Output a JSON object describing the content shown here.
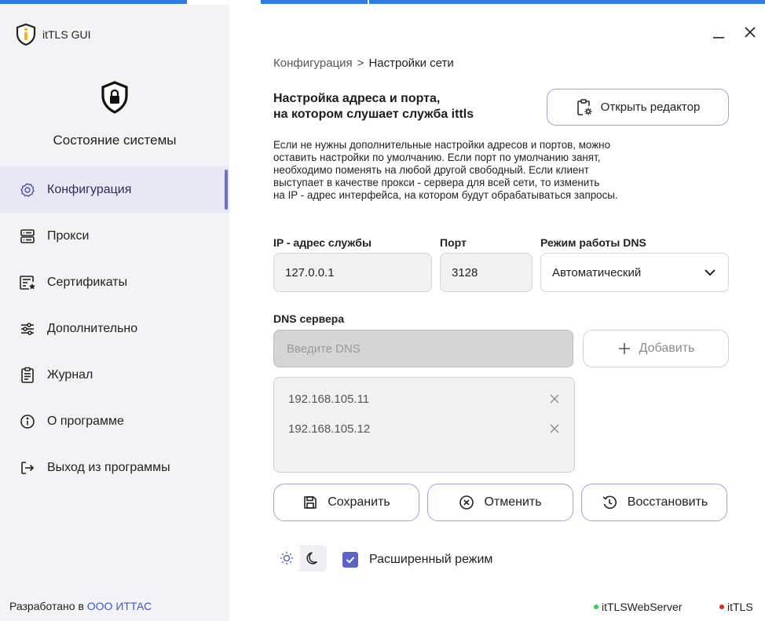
{
  "app": {
    "title": "itTLS GUI"
  },
  "sidebar": {
    "system_state": "Состояние системы",
    "items": [
      {
        "label": "Конфигурация",
        "icon": "gear-icon",
        "active": true
      },
      {
        "label": "Прокси",
        "icon": "server-icon"
      },
      {
        "label": "Сертификаты",
        "icon": "certificate-icon"
      },
      {
        "label": "Дополнительно",
        "icon": "sliders-icon"
      },
      {
        "label": "Журнал",
        "icon": "clipboard-icon"
      },
      {
        "label": "О программе",
        "icon": "info-icon"
      },
      {
        "label": "Выход из программы",
        "icon": "logout-icon"
      }
    ],
    "footer_prefix": "Разработано в",
    "footer_org": "ООО ИТТАС"
  },
  "breadcrumb": {
    "root": "Конфигурация",
    "separator": ">",
    "current": "Настройки сети"
  },
  "section": {
    "title_line1": "Настройка адреса и порта,",
    "title_line2": "на котором слушает служба ittls",
    "open_editor": "Открыть редактор",
    "description_1": "Если не нужны дополнительные настройки адресов и портов, можно",
    "description_2": "оставить настройки по умолчанию. Если порт по умолчанию занят,",
    "description_3": "необходимо поменять на любой другой свободный. Если клиент",
    "description_4": "выступает в качестве прокси - сервера для всей сети, то изменить",
    "description_5": "на IP - адрес интерфейса, на котором будут обрабатываться запросы."
  },
  "fields": {
    "ip_label": "IP - адрес службы",
    "ip_value": "127.0.0.1",
    "port_label": "Порт",
    "port_value": "3128",
    "dns_mode_label": "Режим работы DNS",
    "dns_mode_value": "Автоматический"
  },
  "dns": {
    "label": "DNS сервера",
    "placeholder": "Введите DNS",
    "add_button": "Добавить",
    "servers": [
      "192.168.105.11",
      "192.168.105.12"
    ]
  },
  "actions": {
    "save": "Сохранить",
    "cancel": "Отменить",
    "restore": "Восстановить"
  },
  "advanced_mode": {
    "label": "Расширенный режим",
    "checked": true
  },
  "status": [
    {
      "name": "itTLSWebServer",
      "color": "#3ccf4e"
    },
    {
      "name": "itTLS",
      "color": "#e5262b"
    }
  ],
  "colors": {
    "accent": "#5b63c8",
    "border_accent": "#9ea3dc",
    "org_link": "#3d57c7",
    "brand_yellow": "#f2b51c"
  }
}
